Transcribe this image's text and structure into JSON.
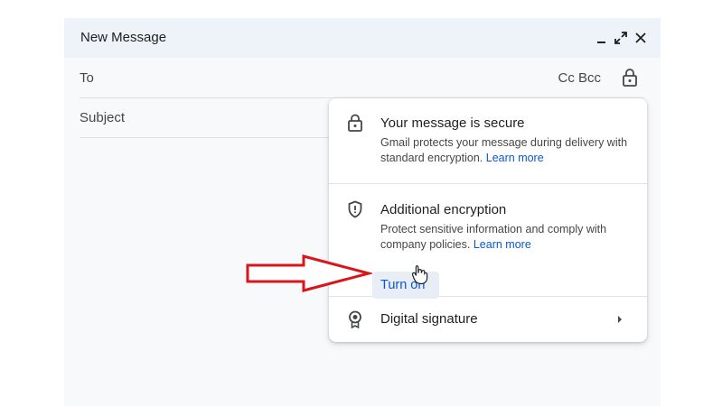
{
  "compose": {
    "title": "New Message",
    "to_label": "To",
    "cc_bcc": "Cc Bcc",
    "subject_placeholder": "Subject"
  },
  "popup": {
    "secure": {
      "title": "Your message is secure",
      "desc": "Gmail protects your message during delivery with standard encryption.",
      "link": "Learn more"
    },
    "encryption": {
      "title": "Additional encryption",
      "desc": "Protect sensitive information and comply with company policies.",
      "link": "Learn more",
      "button": "Turn on"
    },
    "signature": {
      "title": "Digital signature"
    }
  },
  "colors": {
    "header_bg": "#eef2f9",
    "link": "#0b57d0",
    "annotation_arrow": "#d9151b"
  },
  "icons": [
    "minimize-icon",
    "expand-icon",
    "close-icon",
    "lock-icon",
    "shield-icon",
    "signature-badge-icon",
    "chevron-right-icon",
    "hand-cursor-icon"
  ]
}
